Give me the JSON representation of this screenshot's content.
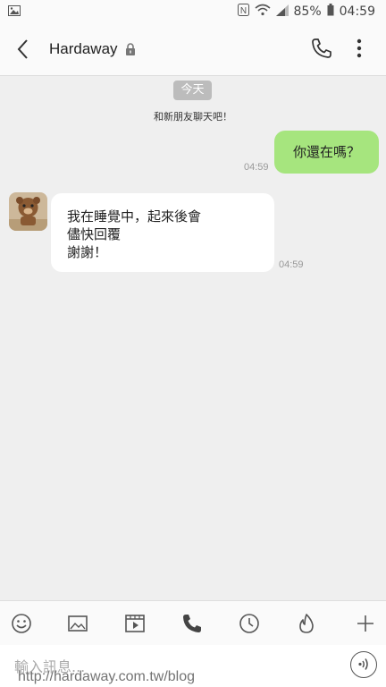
{
  "status_bar": {
    "battery_percent": "85%",
    "time": "04:59",
    "icons": [
      "image-icon",
      "nfc-icon",
      "wifi-icon",
      "signal-icon",
      "battery-icon"
    ]
  },
  "header": {
    "title": "Hardaway",
    "icons": [
      "back-icon",
      "lock-icon",
      "phone-icon",
      "more-vertical-icon"
    ]
  },
  "chat": {
    "date_label": "今天",
    "system_message": "和新朋友聊天吧！",
    "messages": [
      {
        "direction": "outgoing",
        "text": "你還在嗎？",
        "time": "04:59"
      },
      {
        "direction": "incoming",
        "lines": [
          "我在睡覺中，起來後會",
          "儘快回覆",
          "謝謝！"
        ],
        "time": "04:59"
      }
    ]
  },
  "toolbar": {
    "items": [
      "emoji-icon",
      "image-icon",
      "video-icon",
      "phone-icon",
      "clock-icon",
      "flame-icon",
      "plus-icon"
    ]
  },
  "input": {
    "placeholder": "輸入訊息..."
  },
  "watermark": "http://hardaway.com.tw/blog",
  "colors": {
    "outgoing_bubble": "#a6e57e",
    "chat_background": "#efefef"
  }
}
